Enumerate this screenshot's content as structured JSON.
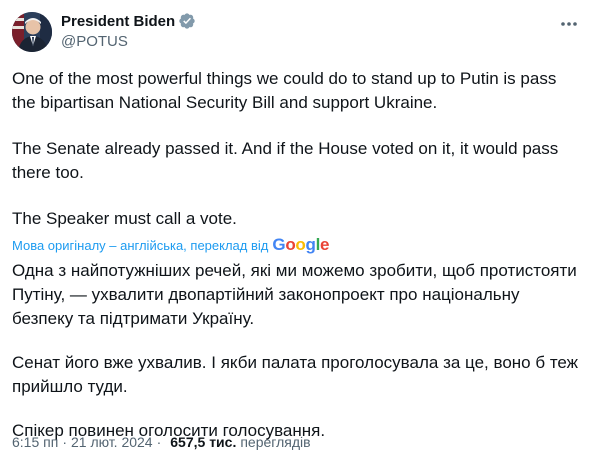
{
  "author": {
    "name": "President Biden",
    "handle": "@POTUS",
    "verified_color": "#829aab"
  },
  "tweet": {
    "paragraphs": [
      "One of the most powerful things we could do to stand up to Putin is pass the bipartisan National Security Bill and support Ukraine.",
      "The Senate already passed it. And if the House voted on it, it would pass there too.",
      "The Speaker must call a vote."
    ]
  },
  "translation": {
    "notice": "Мова оригіналу – англійська, переклад від",
    "provider": "Google",
    "paragraphs": [
      "Одна з найпотужніших речей, які ми можемо зробити, щоб протистояти Путіну, — ухвалити двопартійний законопроект про національну безпеку та підтримати Україну.",
      "Сенат його вже ухвалив. І якби палата проголосувала за це, воно б теж прийшло туди.",
      "Спікер повинен оголосити голосування."
    ]
  },
  "meta": {
    "time": "6:15 пп",
    "date": "21 лют. 2024",
    "separator": "·",
    "views_count": "657,5 тис.",
    "views_label": "переглядів"
  },
  "icons": {
    "more": "more-horizontal-icon",
    "verified": "verified-badge-icon"
  },
  "colors": {
    "link": "#1d9bf0",
    "secondary_text": "#536471",
    "primary_text": "#0f1419"
  }
}
